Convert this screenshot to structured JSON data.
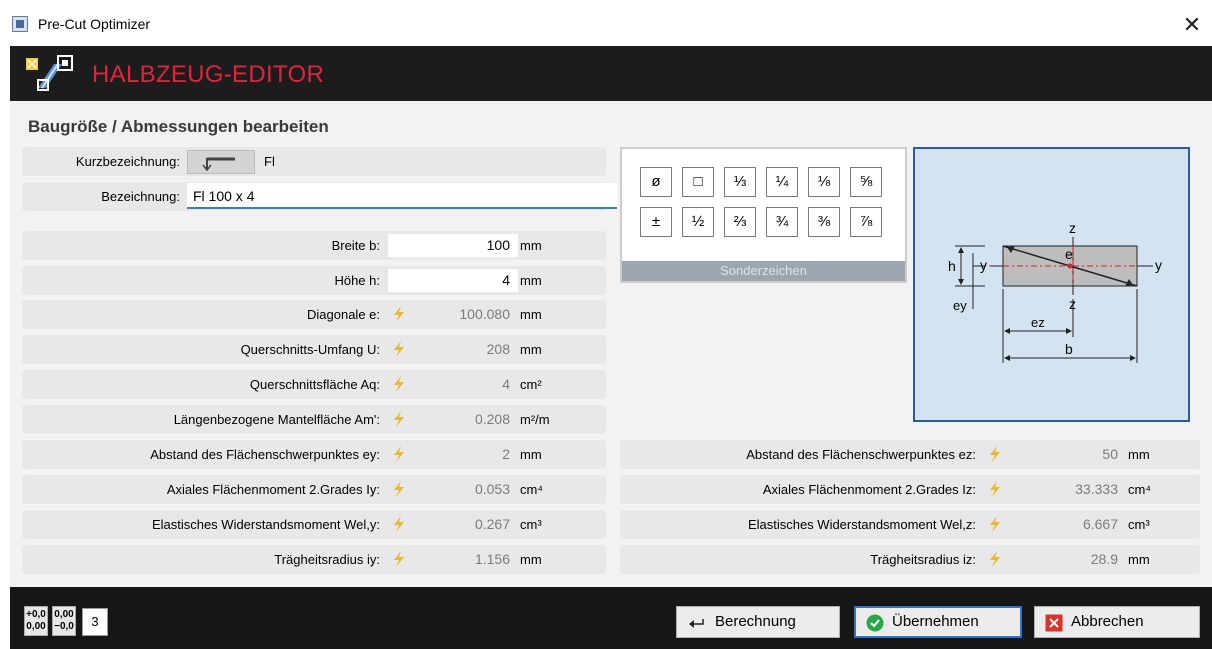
{
  "window": {
    "title": "Pre-Cut Optimizer",
    "close_glyph": "✕"
  },
  "header": {
    "title": "HALBZEUG-EDITOR",
    "title_color": "#e0243c",
    "logo_icon": "profile-editor-icon"
  },
  "section": {
    "title": "Baugröße / Abmessungen bearbeiten"
  },
  "kurzbezeichnung": {
    "label": "Kurzbezeichnung:",
    "value": "Fl",
    "icon": "flat-bar-profile-icon"
  },
  "bezeichnung": {
    "label": "Bezeichnung:",
    "value": "Fl 100 x 4"
  },
  "left_params": [
    {
      "label": "Breite b:",
      "value": "100",
      "unit": "mm",
      "editable": true
    },
    {
      "label": "Höhe h:",
      "value": "4",
      "unit": "mm",
      "editable": true
    },
    {
      "label": "Diagonale e:",
      "value": "100.080",
      "unit": "mm",
      "editable": false
    },
    {
      "label": "Querschnitts-Umfang U:",
      "value": "208",
      "unit": "mm",
      "editable": false
    },
    {
      "label": "Querschnittsfläche Aq:",
      "value": "4",
      "unit": "cm²",
      "editable": false
    },
    {
      "label": "Längenbezogene Mantelfläche Am':",
      "value": "0.208",
      "unit": "m²/m",
      "editable": false
    },
    {
      "label": "Abstand des Flächenschwerpunktes ey:",
      "value": "2",
      "unit": "mm",
      "editable": false
    },
    {
      "label": "Axiales Flächenmoment 2.Grades Iy:",
      "value": "0.053",
      "unit": "cm⁴",
      "editable": false
    },
    {
      "label": "Elastisches Widerstandsmoment Wel,y:",
      "value": "0.267",
      "unit": "cm³",
      "editable": false
    },
    {
      "label": "Trägheitsradius iy:",
      "value": "1.156",
      "unit": "mm",
      "editable": false
    }
  ],
  "right_params": [
    {
      "label": "Abstand des Flächenschwerpunktes ez:",
      "value": "50",
      "unit": "mm"
    },
    {
      "label": "Axiales Flächenmoment 2.Grades Iz:",
      "value": "33.333",
      "unit": "cm⁴"
    },
    {
      "label": "Elastisches Widerstandsmoment Wel,z:",
      "value": "6.667",
      "unit": "cm³"
    },
    {
      "label": "Trägheitsradius iz:",
      "value": "28.9",
      "unit": "mm"
    }
  ],
  "special_chars": {
    "caption": "Sonderzeichen",
    "row1": [
      "ø",
      "□",
      "⅓",
      "¼",
      "⅛",
      "⅝"
    ],
    "row2": [
      "±",
      "½",
      "⅔",
      "¾",
      "⅜",
      "⅞"
    ]
  },
  "diagram": {
    "labels": {
      "z_top": "z",
      "z_bottom": "z",
      "y_left": "y",
      "y_right": "y",
      "e": "e",
      "h": "h",
      "ey": "ey",
      "ez": "ez",
      "b": "b"
    }
  },
  "bottom": {
    "fmt_plus": [
      "+0,0",
      "0,00"
    ],
    "fmt_minus": [
      "0,00",
      "−0,0"
    ],
    "precision": "3",
    "buttons": {
      "berechnung": "Berechnung",
      "uebernehmen": "Übernehmen",
      "abbrechen": "Abbrechen"
    }
  },
  "colors": {
    "bolt": "#e8b830",
    "accent": "#2b74d3",
    "calc_text": "#7b7b7b",
    "ok_green": "#29a847",
    "cancel_red": "#d9342b"
  }
}
